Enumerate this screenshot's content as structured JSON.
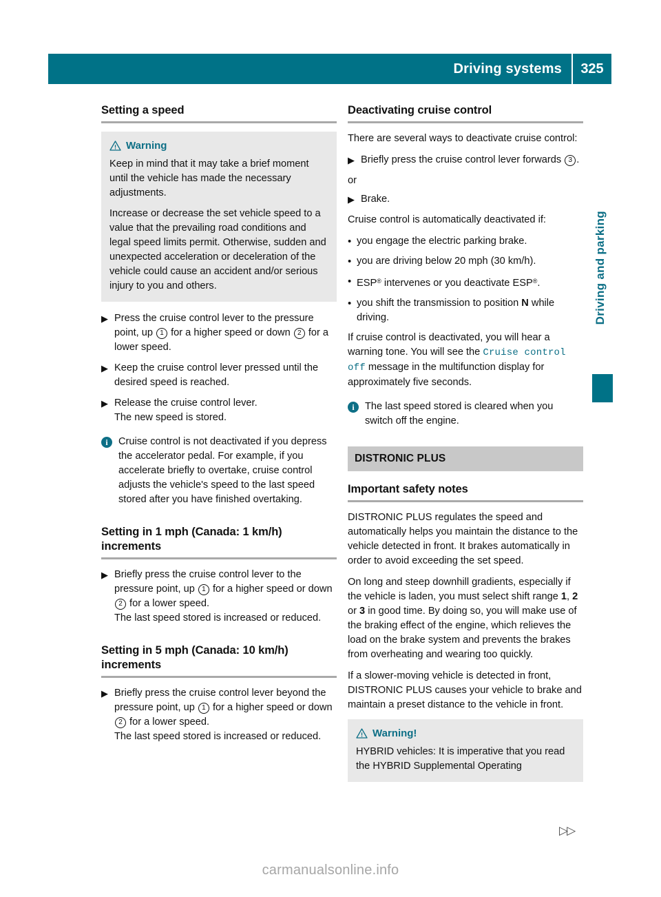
{
  "header": {
    "title": "Driving systems",
    "page_number": "325"
  },
  "side_tab": {
    "label": "Driving and parking"
  },
  "footer": {
    "arrows": "▷▷",
    "watermark": "carmanualsonline.info"
  },
  "icons": {
    "warning_triangle": "warning-triangle-icon",
    "info": "i",
    "step_marker": "▶",
    "dot_marker": "•"
  },
  "left_column": {
    "heading": "Setting a speed",
    "warning": {
      "title": "Warning",
      "paragraphs": [
        "Keep in mind that it may take a brief moment until the vehicle has made the necessary adjustments.",
        "Increase or decrease the set vehicle speed to a value that the prevailing road conditions and legal speed limits permit. Otherwise, sudden and unexpected acceleration or deceleration of the vehicle could cause an accident and/or serious injury to you and others."
      ]
    },
    "steps": [
      {
        "pre": "Press the cruise control lever to the pressure point, up ",
        "num1": "1",
        "mid": " for a higher speed or down ",
        "num2": "2",
        "post": " for a lower speed."
      },
      {
        "text": "Keep the cruise control lever pressed until the desired speed is reached."
      },
      {
        "text": "Release the cruise control lever.",
        "sub": "The new speed is stored."
      }
    ],
    "info_note": "Cruise control is not deactivated if you depress the accelerator pedal. For example, if you accelerate briefly to overtake, cruise control adjusts the vehicle's speed to the last speed stored after you have finished overtaking.",
    "heading_1mph": "Setting in 1 mph (Canada: 1 km/h) increments",
    "step_1mph": {
      "pre": "Briefly press the cruise control lever to the pressure point, up ",
      "num1": "1",
      "mid": " for a higher speed or down ",
      "num2": "2",
      "post": " for a lower speed.",
      "sub": "The last speed stored is increased or reduced."
    },
    "heading_5mph": "Setting in 5 mph (Canada: 10 km/h) increments",
    "step_5mph": {
      "pre": "Briefly press the cruise control lever beyond the pressure point, up ",
      "num1": "1",
      "mid": " for a higher speed or down ",
      "num2": "2",
      "post": " for a lower speed.",
      "sub": "The last speed stored is increased or reduced."
    }
  },
  "right_column": {
    "heading": "Deactivating cruise control",
    "intro": "There are several ways to deactivate cruise control:",
    "step_forwards": {
      "pre": "Briefly press the cruise control lever forwards ",
      "num": "3",
      "post": "."
    },
    "or_label": "or",
    "step_brake": "Brake.",
    "auto_intro": "Cruise control is automatically deactivated if:",
    "auto_bullets": [
      {
        "text": "you engage the electric parking brake."
      },
      {
        "text": "you are driving below 20 mph (30 km/h)."
      },
      {
        "esp": true,
        "pre": "ESP",
        "mid": " intervenes or you deactivate ESP",
        "post": ".",
        "reg": "®"
      },
      {
        "shift": true,
        "pre": "you shift the transmission to position ",
        "bold": "N",
        "post": " while driving."
      }
    ],
    "warn_tone_pre": "If cruise control is deactivated, you will hear a warning tone. You will see the ",
    "warn_tone_mono": "Cruise control off",
    "warn_tone_post": " message in the multifunction display for approximately five seconds.",
    "info_note": "The last speed stored is cleared when you switch off the engine.",
    "banner": "DISTRONIC PLUS",
    "safety_heading": "Important safety notes",
    "para_1": "DISTRONIC PLUS regulates the speed and automatically helps you maintain the distance to the vehicle detected in front. It brakes automatically in order to avoid exceeding the set speed.",
    "para_2": {
      "pre": "On long and steep downhill gradients, especially if the vehicle is laden, you must select shift range ",
      "r1": "1",
      "sep1": ", ",
      "r2": "2",
      "sep2": " or ",
      "r3": "3",
      "post": " in good time. By doing so, you will make use of the braking effect of the engine, which relieves the load on the brake system and prevents the brakes from overheating and wearing too quickly."
    },
    "para_3": "If a slower-moving vehicle is detected in front, DISTRONIC PLUS causes your vehicle to brake and maintain a preset distance to the vehicle in front.",
    "warning": {
      "title": "Warning!",
      "text": "HYBRID vehicles: It is imperative that you read the HYBRID Supplemental Operating"
    }
  }
}
